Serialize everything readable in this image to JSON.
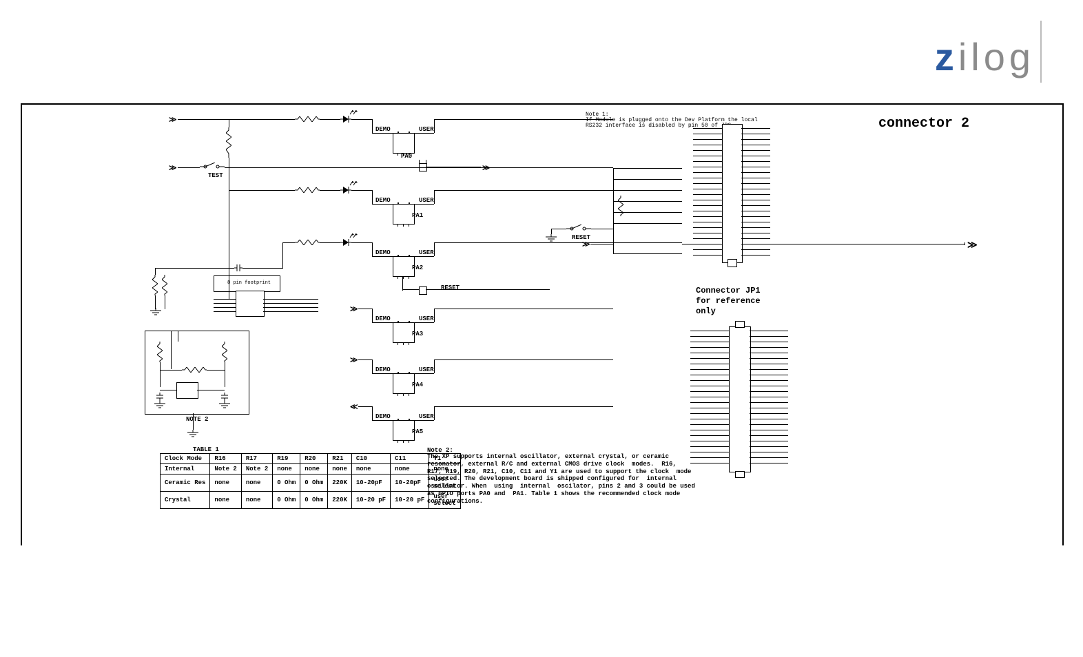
{
  "logo": {
    "prefix": "z",
    "suffix": "ilog"
  },
  "titles": {
    "conn2": "connector 2",
    "jp1a": "Connector JP1",
    "jp1b": "for reference",
    "jp1c": "only"
  },
  "notes": {
    "n1a": "Note 1:",
    "n1b": "If Module is plugged onto the Dev Platform the local",
    "n1c": "RS232 interface is disabled by pin 50 of JP2",
    "n2title": "Note 2:",
    "n2body": "The XP supports internal oscillator, external crystal, or ceramic\nresonator, external R/C and external CMOS drive clock  modes.  R16,\nR17, R19, R20, R21, C10, C11 and Y1 are used to support the clock  mode\nselected. The development board is shipped configured for  internal\noscillator. When  using  internal  oscilator, pins 2 and 3 could be used\nas GPIO ports PA0 and  PA1. Table 1 shows the recommended clock mode\nconfigurations."
  },
  "labels": {
    "test": "TEST",
    "reset": "RESET",
    "reset2": "RESET",
    "fp": "8 pin footprint",
    "pa0": "PA0",
    "pa1": "PA1",
    "pa2": "PA2",
    "pa3": "PA3",
    "pa4": "PA4",
    "pa5": "PA5",
    "demo": "DEMO",
    "user": "USER",
    "table1": "TABLE 1",
    "note2": "NOTE 2"
  },
  "chart_data": {
    "type": "table",
    "title": "TABLE 1",
    "columns": [
      "Clock Mode",
      "R16",
      "R17",
      "R19",
      "R20",
      "R21",
      "C10",
      "C11",
      "Y1"
    ],
    "rows": [
      [
        "Internal",
        "Note 2",
        "Note 2",
        "none",
        "none",
        "none",
        "none",
        "none",
        "none"
      ],
      [
        "Ceramic Res",
        "none",
        "none",
        "0 Ohm",
        "0 Ohm",
        "220K",
        "10-20pF",
        "10-20pF",
        "user select"
      ],
      [
        "Crystal",
        "none",
        "none",
        "0 Ohm",
        "0 Ohm",
        "220K",
        "10-20 pF",
        "10-20 pF",
        "user select"
      ]
    ]
  }
}
